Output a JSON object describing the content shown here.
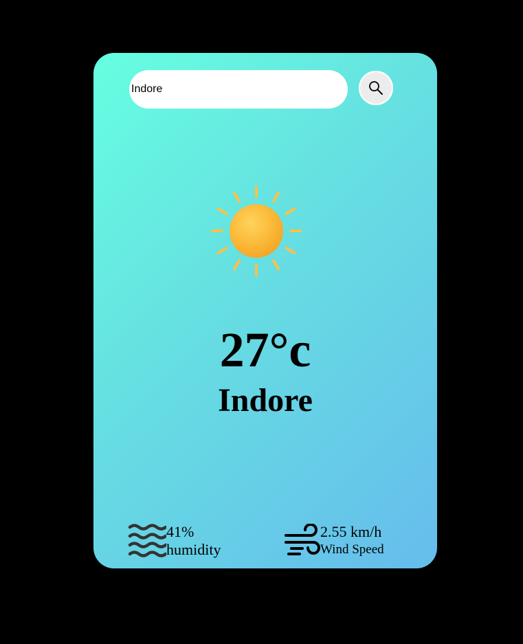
{
  "search": {
    "value": "Indore",
    "placeholder": ""
  },
  "weather": {
    "icon": "sun-icon",
    "temperature": "27°c",
    "city": "Indore"
  },
  "details": {
    "humidity": {
      "icon": "humidity-waves-icon",
      "value": "41%",
      "label": "humidity"
    },
    "wind": {
      "icon": "wind-icon",
      "value": "2.55 km/h",
      "label": "Wind Speed"
    }
  },
  "colors": {
    "background": "#000000",
    "card_gradient_start": "#66ffe1",
    "card_gradient_end": "#66bcec",
    "sun": "#fbb837",
    "sun_rays": "#f8c14a"
  }
}
